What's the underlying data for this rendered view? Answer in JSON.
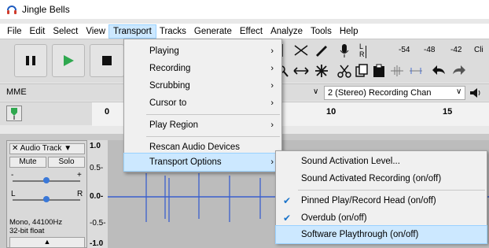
{
  "window": {
    "title": "Jingle Bells"
  },
  "menubar": {
    "items": [
      {
        "label": "File",
        "name": "menu-file"
      },
      {
        "label": "Edit",
        "name": "menu-edit"
      },
      {
        "label": "Select",
        "name": "menu-select"
      },
      {
        "label": "View",
        "name": "menu-view"
      },
      {
        "label": "Transport",
        "name": "menu-transport",
        "active": true
      },
      {
        "label": "Tracks",
        "name": "menu-tracks"
      },
      {
        "label": "Generate",
        "name": "menu-generate"
      },
      {
        "label": "Effect",
        "name": "menu-effect"
      },
      {
        "label": "Analyze",
        "name": "menu-analyze"
      },
      {
        "label": "Tools",
        "name": "menu-tools"
      },
      {
        "label": "Help",
        "name": "menu-help"
      }
    ]
  },
  "meter": {
    "l": "L",
    "r": "R",
    "ticks": [
      "-54",
      "-48",
      "-42"
    ],
    "cli": "Cli"
  },
  "device": {
    "host": "MME",
    "h_fragment": "h",
    "recording_channels": "2 (Stereo) Recording Chan"
  },
  "ruler": {
    "ticks": [
      "0",
      "10",
      "15"
    ]
  },
  "track": {
    "name": "Audio Track",
    "mute": "Mute",
    "solo": "Solo",
    "gain_minus": "-",
    "gain_plus": "+",
    "pan_l": "L",
    "pan_r": "R",
    "info_line1": "Mono, 44100Hz",
    "info_line2": "32-bit float",
    "y_labels": [
      "1.0",
      "0.5-",
      "0.0-",
      "-0.5-",
      "-1.0"
    ]
  },
  "transport_menu": {
    "items": [
      {
        "label": "Playing",
        "submenu": true
      },
      {
        "label": "Recording",
        "submenu": true
      },
      {
        "label": "Scrubbing",
        "submenu": true
      },
      {
        "label": "Cursor to",
        "submenu": true
      },
      {
        "label": "Play Region",
        "submenu": true
      },
      {
        "label": "Rescan Audio Devices",
        "submenu": false
      },
      {
        "label": "Transport Options",
        "submenu": true,
        "highlighted": true
      }
    ]
  },
  "transport_options_menu": {
    "items": [
      {
        "label": "Sound Activation Level...",
        "checked": false
      },
      {
        "label": "Sound Activated Recording (on/off)",
        "checked": false
      },
      {
        "label": "Pinned Play/Record Head (on/off)",
        "checked": true
      },
      {
        "label": "Overdub (on/off)",
        "checked": true
      },
      {
        "label": "Software Playthrough (on/off)",
        "checked": false,
        "highlighted": true
      }
    ]
  },
  "colors": {
    "accent": "#1a73c9",
    "highlight": "#cce8ff",
    "waveform": "#3a5fcd"
  },
  "waveform_spikes": [
    0.1,
    0.15,
    0.16,
    0.24,
    0.32,
    0.4,
    0.49,
    0.56,
    0.62,
    0.7,
    0.74,
    0.8,
    0.86,
    0.9,
    0.95
  ]
}
